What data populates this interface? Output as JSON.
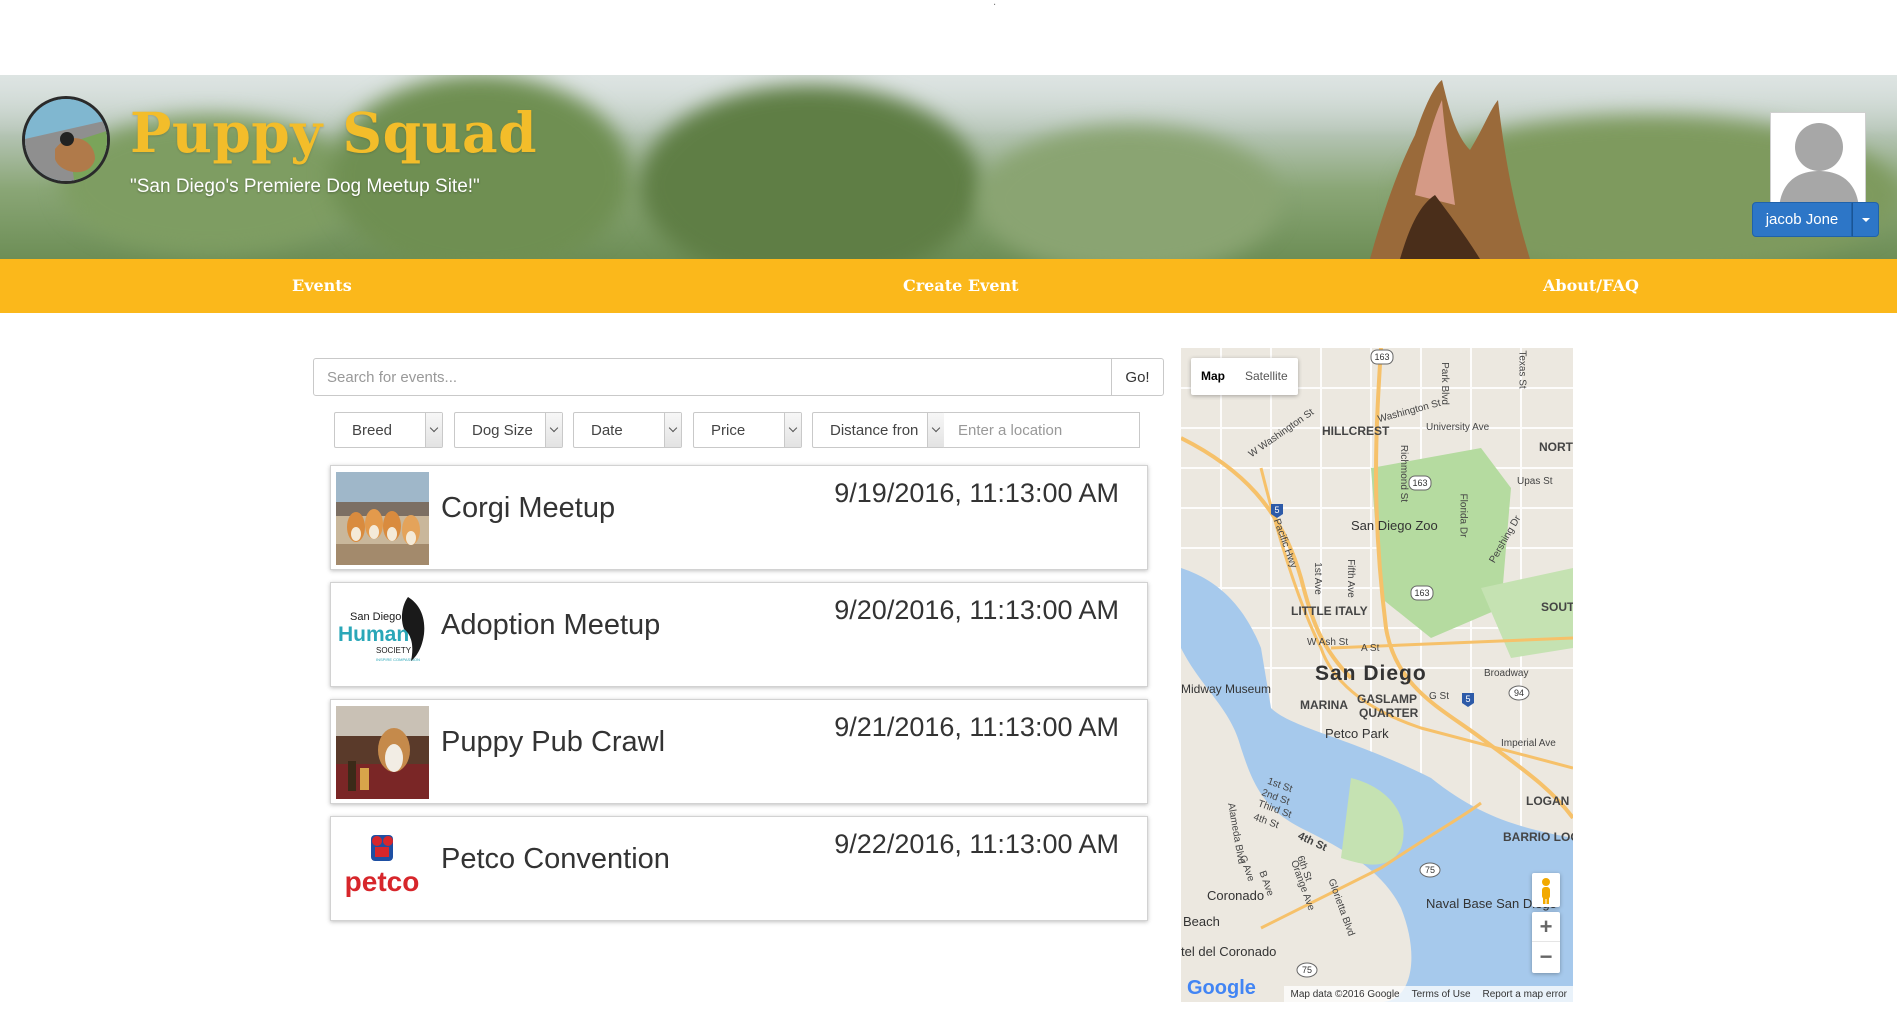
{
  "header": {
    "title": "Puppy Squad",
    "tagline": "\"San Diego's Premiere Dog Meetup Site!\"",
    "user": {
      "name": "jacob Jone"
    }
  },
  "nav": {
    "items": [
      {
        "label": "Events"
      },
      {
        "label": "Create Event"
      },
      {
        "label": "About/FAQ"
      }
    ]
  },
  "search": {
    "placeholder": "Search for events...",
    "go_label": "Go!"
  },
  "filters": {
    "breed": "Breed",
    "dog_size": "Dog Size",
    "date": "Date",
    "price": "Price",
    "distance": "Distance fron",
    "location_placeholder": "Enter a location"
  },
  "events": [
    {
      "name": "Corgi Meetup",
      "date": "9/19/2016, 11:13:00 AM"
    },
    {
      "name": "Adoption Meetup",
      "date": "9/20/2016, 11:13:00 AM"
    },
    {
      "name": "Puppy Pub Crawl",
      "date": "9/21/2016, 11:13:00 AM"
    },
    {
      "name": "Petco Convention",
      "date": "9/22/2016, 11:13:00 AM"
    }
  ],
  "thumbnails": {
    "humane_line1": "San Diego",
    "humane_line2": "Humane",
    "humane_line3": "SOCIETY",
    "humane_line4": "INSPIRE COMPASSION",
    "petco": "petco"
  },
  "map": {
    "type_map": "Map",
    "type_satellite": "Satellite",
    "labels": {
      "hillcrest": "HILLCREST",
      "washington_st": "Washington St",
      "university_ave": "University Ave",
      "w_washington_st": "W Washington St",
      "park_blvd": "Park Blvd",
      "texas_st": "Texas St",
      "north": "NORT",
      "upas_st": "Upas St",
      "zoo": "San Diego Zoo",
      "pacific_hwy": "Pacific Hwy",
      "first_ave": "1st Ave",
      "fifth_ave": "Fifth Ave",
      "richmond_st": "Richmond St",
      "florida_dr": "Florida Dr",
      "pershing_dr": "Pershing Dr",
      "south": "SOUT",
      "little_italy": "LITTLE ITALY",
      "w_ash_st": "W Ash St",
      "a_st": "A St",
      "san_diego": "San Diego",
      "broadway": "Broadway",
      "museum": "Midway Museum",
      "marina": "MARINA",
      "gaslamp": "GASLAMP",
      "quarter": "QUARTER",
      "g_st": "G St",
      "petco_park": "Petco Park",
      "imperial_ave": "Imperial Ave",
      "logan": "LOGAN",
      "barrio_logan": "BARRIO LOGAN",
      "coronado": "Coronado",
      "naval_base": "Naval Base San Diego",
      "beach": "Beach",
      "del_coronado": "tel del Coronado",
      "fourth_st": "4th St",
      "alameda_blvd": "Alameda Blvd",
      "first_st": "1st St",
      "second_st": "2nd St",
      "third_st": "Third St",
      "fourth_st_small": "4th St",
      "g_ave": "G Ave",
      "b_ave": "B Ave",
      "sixth_st": "6th St",
      "orange_ave": "Orange Ave",
      "glorietta_blvd": "Glorietta Blvd",
      "route_163a": "163",
      "route_163b": "163",
      "route_163c": "163",
      "route_5a": "5",
      "route_5b": "5",
      "route_94": "94",
      "route_75a": "75",
      "route_75b": "75"
    },
    "zoom_in": "+",
    "zoom_out": "−",
    "google": "Google",
    "attribution": {
      "data": "Map data ©2016 Google",
      "terms": "Terms of Use",
      "report": "Report a map error"
    }
  },
  "colors": {
    "accent": "#fbb81b",
    "title": "#f3bd2a",
    "button": "#2d76c7"
  }
}
